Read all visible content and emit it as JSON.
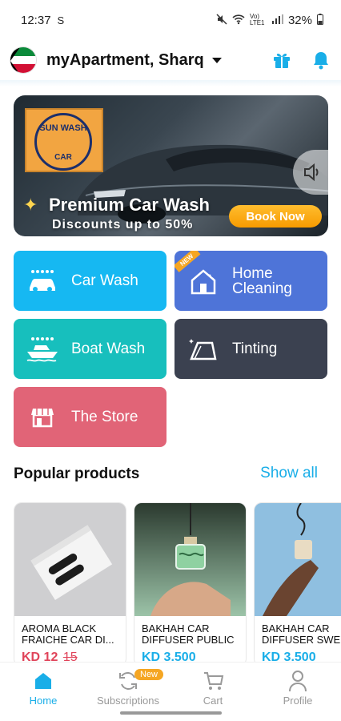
{
  "status_bar": {
    "time": "12:37",
    "sync_icon": "S",
    "network": "Vo) LTE1",
    "battery": "32%"
  },
  "header": {
    "location": "myApartment, Sharq",
    "icons": [
      "kuwait-flag",
      "gift-icon",
      "bell-icon"
    ]
  },
  "banner": {
    "logo_top": "SUN WASH",
    "logo_bottom": "CAR",
    "title": "Premium Car Wash",
    "subtitle": "Discounts up to 50%",
    "cta": "Book Now"
  },
  "services": {
    "car_wash": "Car Wash",
    "home_cleaning_1": "Home",
    "home_cleaning_2": "Cleaning",
    "home_badge": "NEW",
    "boat_wash": "Boat Wash",
    "tinting": "Tinting",
    "store": "The Store"
  },
  "popular": {
    "title": "Popular products",
    "show_all": "Show all",
    "items": [
      {
        "name": "AROMA BLACK FRAICHE CAR DI...",
        "price": "KD 12",
        "old_price": "15"
      },
      {
        "name": "BAKHAH CAR DIFFUSER PUBLIC",
        "price": "KD 3.500"
      },
      {
        "name": "BAKHAH CAR DIFFUSER SWE",
        "price": "KD 3.500"
      }
    ]
  },
  "nav": {
    "home": "Home",
    "subscriptions": "Subscriptions",
    "subs_badge": "New",
    "cart": "Cart",
    "profile": "Profile"
  },
  "colors": {
    "accent": "#19aee8",
    "car_wash": "#16b8f2",
    "home_cleaning": "#4e74d8",
    "boat_wash": "#17bfbd",
    "tinting": "#3b4150",
    "store": "#e16477",
    "book_now": "#f79b00"
  }
}
